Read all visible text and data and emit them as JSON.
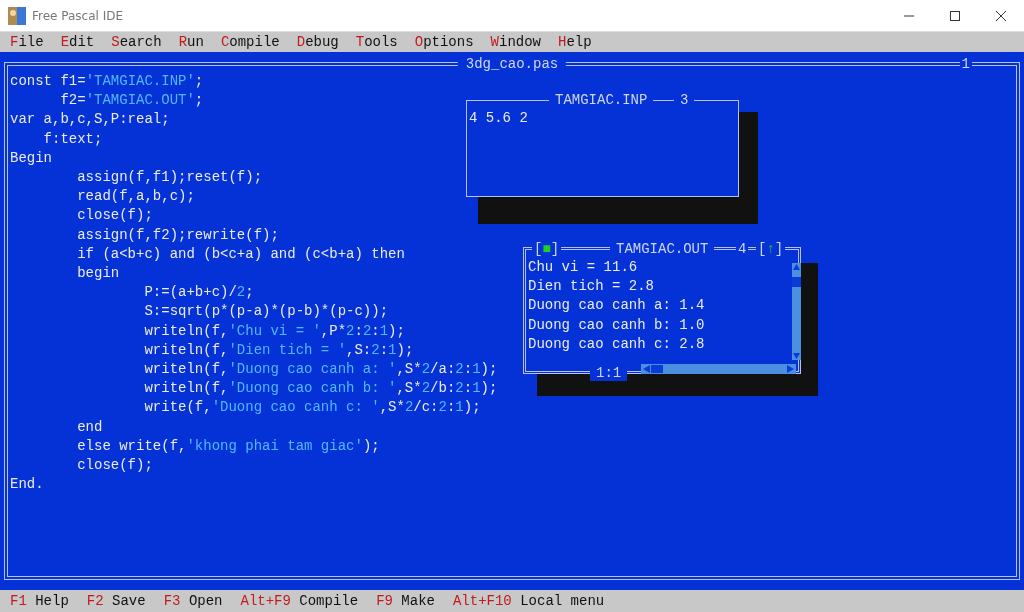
{
  "window": {
    "title": "Free Pascal IDE"
  },
  "menu": [
    {
      "hot": "F",
      "rest": "ile"
    },
    {
      "hot": "E",
      "rest": "dit"
    },
    {
      "hot": "S",
      "rest": "earch"
    },
    {
      "hot": "R",
      "rest": "un"
    },
    {
      "hot": "C",
      "rest": "ompile"
    },
    {
      "hot": "D",
      "rest": "ebug"
    },
    {
      "hot": "T",
      "rest": "ools"
    },
    {
      "hot": "O",
      "rest": "ptions"
    },
    {
      "hot": "W",
      "rest": "indow"
    },
    {
      "hot": "H",
      "rest": "elp"
    }
  ],
  "editor": {
    "title": "3dg_cao.pas",
    "number": "1",
    "lines": [
      [
        {
          "kind": "plain",
          "text": "const f1="
        },
        {
          "kind": "string",
          "text": "'TAMGIAC.INP'"
        },
        {
          "kind": "plain",
          "text": ";"
        }
      ],
      [
        {
          "kind": "plain",
          "text": "      f2="
        },
        {
          "kind": "string",
          "text": "'TAMGIAC.OUT'"
        },
        {
          "kind": "plain",
          "text": ";"
        }
      ],
      [
        {
          "kind": "plain",
          "text": "var a,b,c,S,P:real;"
        }
      ],
      [
        {
          "kind": "plain",
          "text": "    f:text;"
        }
      ],
      [
        {
          "kind": "plain",
          "text": "Begin"
        }
      ],
      [
        {
          "kind": "plain",
          "text": "        assign(f,f1);reset(f);"
        }
      ],
      [
        {
          "kind": "plain",
          "text": "        read(f,a,b,c);"
        }
      ],
      [
        {
          "kind": "plain",
          "text": "        close(f);"
        }
      ],
      [
        {
          "kind": "plain",
          "text": "        assign(f,f2);rewrite(f);"
        }
      ],
      [
        {
          "kind": "plain",
          "text": "        if (a<b+c) and (b<c+a) and (c<b+a) then"
        }
      ],
      [
        {
          "kind": "plain",
          "text": "        begin"
        }
      ],
      [
        {
          "kind": "plain",
          "text": "                P:=(a+b+c)/"
        },
        {
          "kind": "number",
          "text": "2"
        },
        {
          "kind": "plain",
          "text": ";"
        }
      ],
      [
        {
          "kind": "plain",
          "text": "                S:=sqrt(p*(p-a)*(p-b)*(p-c));"
        }
      ],
      [
        {
          "kind": "plain",
          "text": "                writeln(f,"
        },
        {
          "kind": "string",
          "text": "'Chu vi = '"
        },
        {
          "kind": "plain",
          "text": ",P*"
        },
        {
          "kind": "number",
          "text": "2"
        },
        {
          "kind": "plain",
          "text": ":"
        },
        {
          "kind": "number",
          "text": "2"
        },
        {
          "kind": "plain",
          "text": ":"
        },
        {
          "kind": "number",
          "text": "1"
        },
        {
          "kind": "plain",
          "text": ");"
        }
      ],
      [
        {
          "kind": "plain",
          "text": "                writeln(f,"
        },
        {
          "kind": "string",
          "text": "'Dien tich = '"
        },
        {
          "kind": "plain",
          "text": ",S:"
        },
        {
          "kind": "number",
          "text": "2"
        },
        {
          "kind": "plain",
          "text": ":"
        },
        {
          "kind": "number",
          "text": "1"
        },
        {
          "kind": "plain",
          "text": ");"
        }
      ],
      [
        {
          "kind": "plain",
          "text": "                writeln(f,"
        },
        {
          "kind": "string",
          "text": "'Duong cao canh a: '"
        },
        {
          "kind": "plain",
          "text": ",S*"
        },
        {
          "kind": "number",
          "text": "2"
        },
        {
          "kind": "plain",
          "text": "/a:"
        },
        {
          "kind": "number",
          "text": "2"
        },
        {
          "kind": "plain",
          "text": ":"
        },
        {
          "kind": "number",
          "text": "1"
        },
        {
          "kind": "plain",
          "text": ");"
        }
      ],
      [
        {
          "kind": "plain",
          "text": "                writeln(f,"
        },
        {
          "kind": "string",
          "text": "'Duong cao canh b: '"
        },
        {
          "kind": "plain",
          "text": ",S*"
        },
        {
          "kind": "number",
          "text": "2"
        },
        {
          "kind": "plain",
          "text": "/b:"
        },
        {
          "kind": "number",
          "text": "2"
        },
        {
          "kind": "plain",
          "text": ":"
        },
        {
          "kind": "number",
          "text": "1"
        },
        {
          "kind": "plain",
          "text": ");"
        }
      ],
      [
        {
          "kind": "plain",
          "text": "                write(f,"
        },
        {
          "kind": "string",
          "text": "'Duong cao canh c: '"
        },
        {
          "kind": "plain",
          "text": ",S*"
        },
        {
          "kind": "number",
          "text": "2"
        },
        {
          "kind": "plain",
          "text": "/c:"
        },
        {
          "kind": "number",
          "text": "2"
        },
        {
          "kind": "plain",
          "text": ":"
        },
        {
          "kind": "number",
          "text": "1"
        },
        {
          "kind": "plain",
          "text": ");"
        }
      ],
      [
        {
          "kind": "plain",
          "text": "        end"
        }
      ],
      [
        {
          "kind": "plain",
          "text": "        else write(f,"
        },
        {
          "kind": "string",
          "text": "'khong phai tam giac'"
        },
        {
          "kind": "plain",
          "text": ");"
        }
      ],
      [
        {
          "kind": "plain",
          "text": "        close(f);"
        }
      ],
      [
        {
          "kind": "plain",
          "text": "End."
        }
      ]
    ]
  },
  "input_window": {
    "title": "TAMGIAC.INP",
    "number": "3",
    "lines": [
      "4 5.6 2"
    ]
  },
  "output_window": {
    "title": "TAMGIAC.OUT",
    "number": "4",
    "close_button": {
      "left": "[",
      "glyph": "■",
      "right": "]"
    },
    "zoom_button": {
      "left": "[",
      "glyph": "↑",
      "right": "]"
    },
    "position": "1:1",
    "lines": [
      "Chu vi = 11.6",
      "Dien tich = 2.8",
      "Duong cao canh a: 1.4",
      "Duong cao canh b: 1.0",
      "Duong cao canh c: 2.8"
    ]
  },
  "status_bar": [
    {
      "key": "F1",
      "label": "Help"
    },
    {
      "key": "F2",
      "label": "Save"
    },
    {
      "key": "F3",
      "label": "Open"
    },
    {
      "key": "Alt+F9",
      "label": "Compile"
    },
    {
      "key": "F9",
      "label": "Make"
    },
    {
      "key": "Alt+F10",
      "label": "Local menu"
    }
  ]
}
